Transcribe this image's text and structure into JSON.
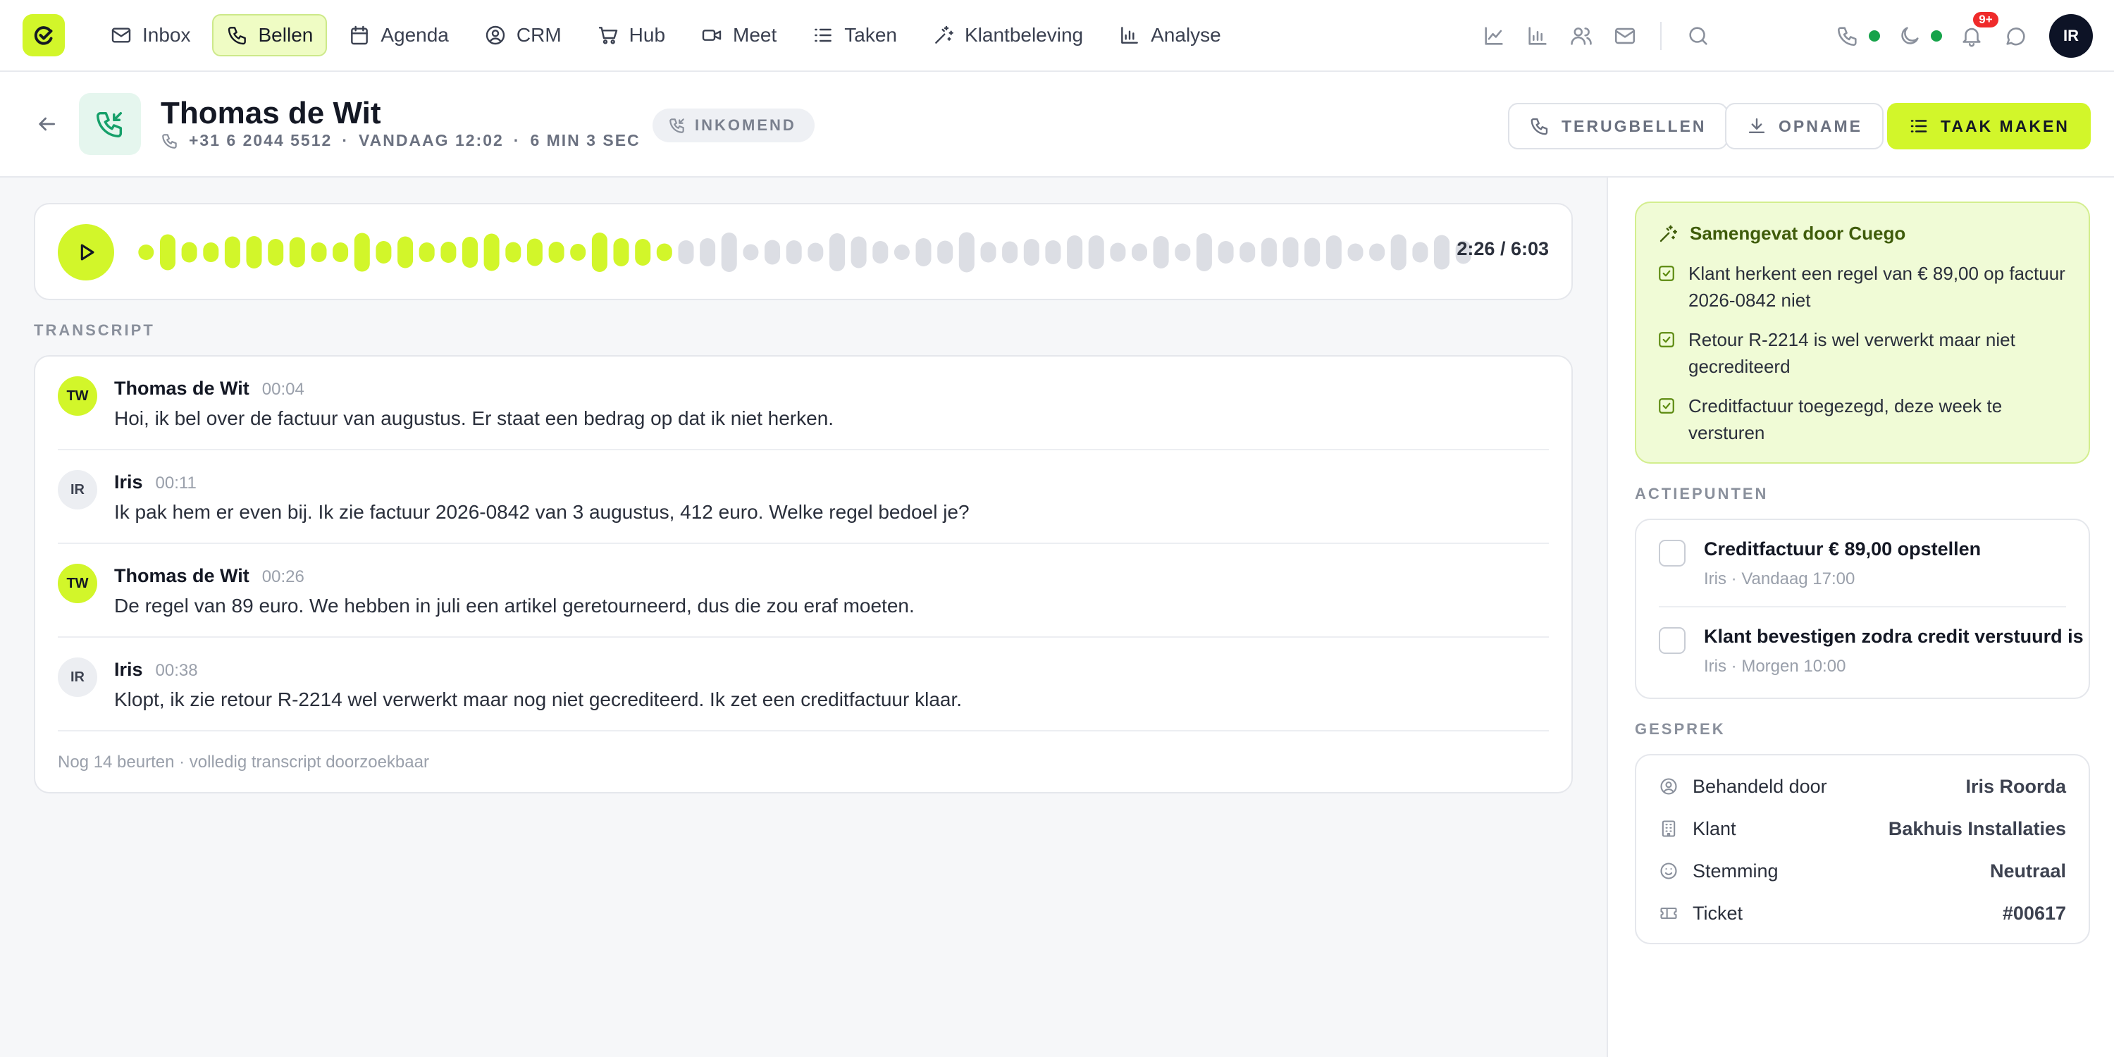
{
  "nav": {
    "items": [
      {
        "label": "Inbox",
        "icon": "mail-icon"
      },
      {
        "label": "Bellen",
        "icon": "phone-icon",
        "active": true
      },
      {
        "label": "Agenda",
        "icon": "calendar-icon"
      },
      {
        "label": "CRM",
        "icon": "user-circle-icon"
      },
      {
        "label": "Hub",
        "icon": "cart-icon"
      },
      {
        "label": "Meet",
        "icon": "video-icon"
      },
      {
        "label": "Taken",
        "icon": "list-icon"
      },
      {
        "label": "Klantbeleving",
        "icon": "sparkle-icon"
      },
      {
        "label": "Analyse",
        "icon": "bar-chart-icon"
      }
    ],
    "notifications_badge": "9+",
    "user_initials": "IR",
    "status_color": "#16a34a"
  },
  "header": {
    "caller_name": "Thomas de Wit",
    "phone": "+31 6 2044 5512",
    "when": "VANDAAG 12:02",
    "duration": "6 MIN 3 SEC",
    "direction": "INKOMEND",
    "callback_label": "TERUGBELLEN",
    "recording_label": "OPNAME",
    "create_task_label": "TAAK MAKEN"
  },
  "player": {
    "time": "2:26 / 6:03",
    "progress": 0.404,
    "accent": "#d2f62a"
  },
  "transcript": {
    "label": "TRANSCRIPT",
    "turns": [
      {
        "initials": "TW",
        "speaker": "Thomas de Wit",
        "time": "00:04",
        "text": "Hoi, ik bel over de factuur van augustus. Er staat een bedrag op dat ik niet herken.",
        "role": "customer"
      },
      {
        "initials": "IR",
        "speaker": "Iris",
        "time": "00:11",
        "text": "Ik pak hem er even bij. Ik zie factuur 2026-0842 van 3 augustus, 412 euro. Welke regel bedoel je?",
        "role": "agent"
      },
      {
        "initials": "TW",
        "speaker": "Thomas de Wit",
        "time": "00:26",
        "text": "De regel van 89 euro. We hebben in juli een artikel geretourneerd, dus die zou eraf moeten.",
        "role": "customer"
      },
      {
        "initials": "IR",
        "speaker": "Iris",
        "time": "00:38",
        "text": "Klopt, ik zie retour R-2214 wel verwerkt maar nog niet gecrediteerd. Ik zet een creditfactuur klaar.",
        "role": "agent"
      }
    ],
    "more_note": "Nog 14 beurten · volledig transcript doorzoekbaar"
  },
  "summary": {
    "title": "Samengevat door Cuego",
    "items": [
      "Klant herkent een regel van € 89,00 op factuur 2026-0842 niet",
      "Retour R-2214 is wel verwerkt maar niet gecrediteerd",
      "Creditfactuur toegezegd, deze week te versturen"
    ]
  },
  "actions": {
    "label": "ACTIEPUNTEN",
    "items": [
      {
        "title": "Creditfactuur € 89,00 opstellen",
        "meta": "Iris · Vandaag 17:00"
      },
      {
        "title": "Klant bevestigen zodra credit verstuurd is",
        "meta": "Iris · Morgen 10:00"
      }
    ]
  },
  "conversation": {
    "label": "GESPREK",
    "rows": [
      {
        "label": "Behandeld door",
        "value": "Iris Roorda",
        "icon": "user-circle-icon"
      },
      {
        "label": "Klant",
        "value": "Bakhuis Installaties",
        "icon": "building-icon"
      },
      {
        "label": "Stemming",
        "value": "Neutraal",
        "icon": "smiley-icon"
      },
      {
        "label": "Ticket",
        "value": "#00617",
        "icon": "ticket-icon"
      }
    ]
  }
}
